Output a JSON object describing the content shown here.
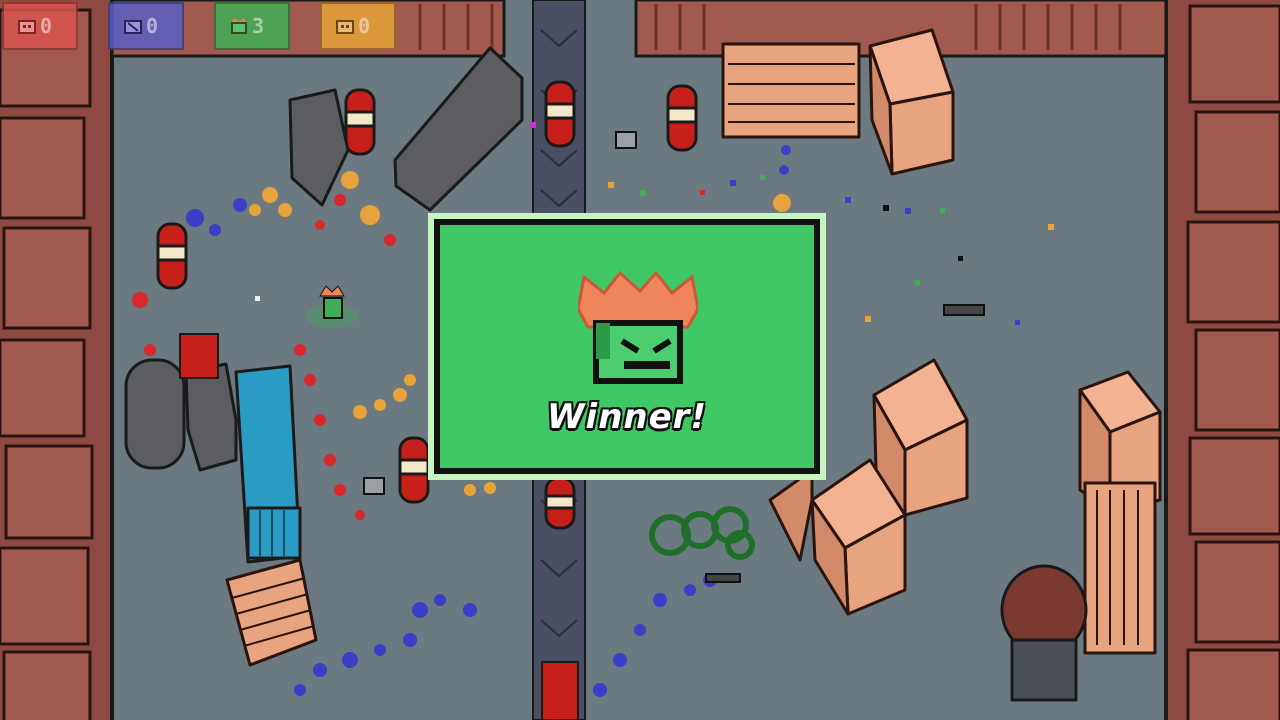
{
  "hud": {
    "players": [
      {
        "id": "red",
        "score": "0",
        "color": "#d9534f",
        "icon": "red-player-face-icon"
      },
      {
        "id": "blue",
        "score": "0",
        "color": "#5a5fc8",
        "icon": "blue-player-face-icon"
      },
      {
        "id": "green",
        "score": "3",
        "color": "#3fae55",
        "icon": "green-player-crowned-face-icon"
      },
      {
        "id": "orange",
        "score": "0",
        "color": "#e8a33a",
        "icon": "orange-player-face-icon"
      }
    ]
  },
  "winner_popup": {
    "title": "Winner!",
    "winner_color": "#41c866",
    "crown_color": "#f0845a",
    "avatar_icon": "crowned-green-player-icon"
  },
  "colors": {
    "floor": "#6b7a80",
    "wall": "#a35a4e",
    "crate": "#e8a37f",
    "barrel_red": "#c7201b",
    "container_blue": "#2a9bc4",
    "conveyor": "#4a4f63"
  }
}
